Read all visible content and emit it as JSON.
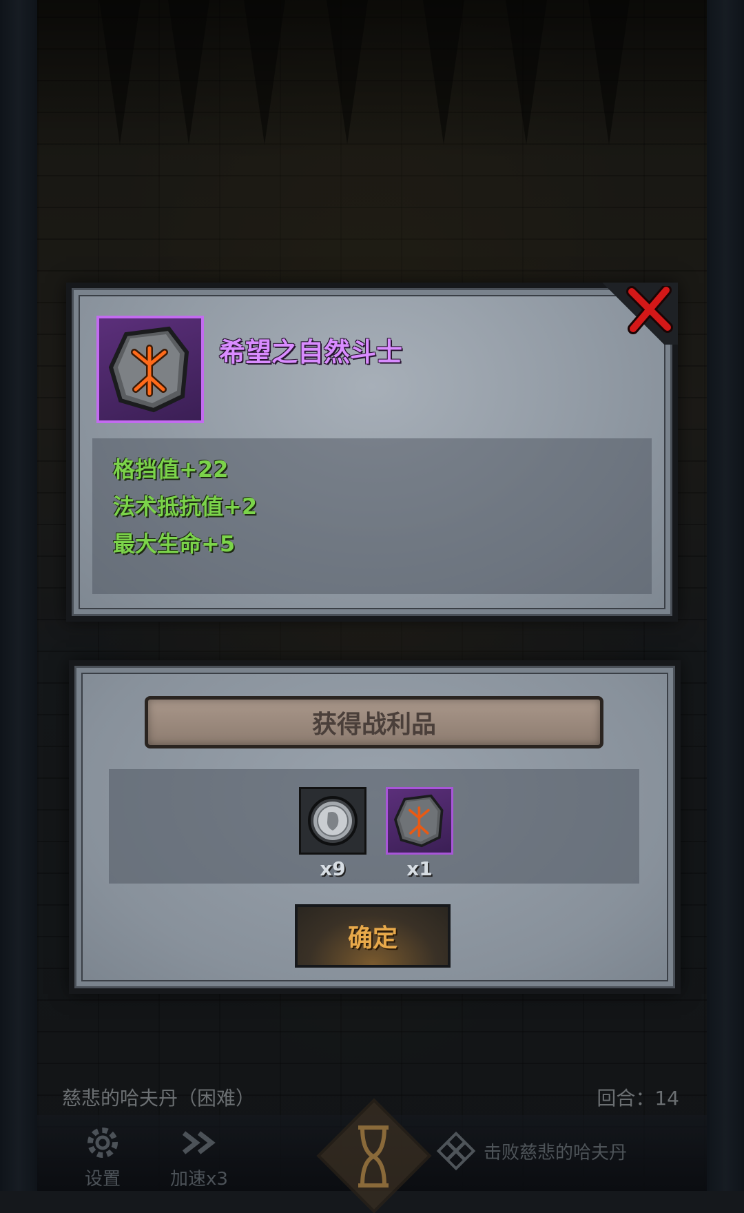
{
  "item": {
    "name": "希望之自然斗士",
    "stats": [
      "格挡值+22",
      "法术抵抗值+2",
      "最大生命+5"
    ]
  },
  "loot": {
    "title": "获得战利品",
    "items": [
      {
        "icon": "silver-coin-icon",
        "count": "x9"
      },
      {
        "icon": "rune-stone-icon",
        "count": "x1"
      }
    ],
    "confirm_label": "确定"
  },
  "hud": {
    "stage": "慈悲的哈夫丹（困难）",
    "round": "回合：14",
    "settings_label": "设置",
    "speed_label": "加速x3",
    "objective": "击败慈悲的哈夫丹"
  },
  "colors": {
    "item_name": "#d98cff",
    "stat_text": "#7bd34a",
    "rarity_border": "#c36bf0",
    "confirm_text": "#e8a94a"
  }
}
